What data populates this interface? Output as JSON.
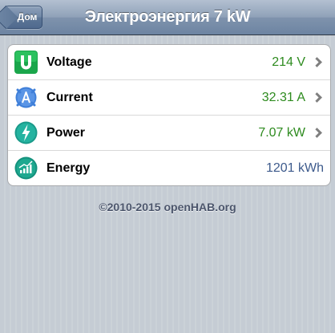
{
  "navbar": {
    "back_label": "Дом",
    "title": "Электроэнергия 7 kW"
  },
  "items": [
    {
      "label": "Voltage",
      "value": "214 V",
      "icon": "voltage-icon",
      "value_color": "#2e8b1f"
    },
    {
      "label": "Current",
      "value": "32.31 A",
      "icon": "current-icon",
      "value_color": "#2e8b1f"
    },
    {
      "label": "Power",
      "value": "7.07 kW",
      "icon": "power-icon",
      "value_color": "#2e8b1f"
    },
    {
      "label": "Energy",
      "value": "1201 kWh",
      "icon": "energy-icon",
      "value_color": "#3d5a8c"
    }
  ],
  "footer": "©2010-2015 openHAB.org"
}
